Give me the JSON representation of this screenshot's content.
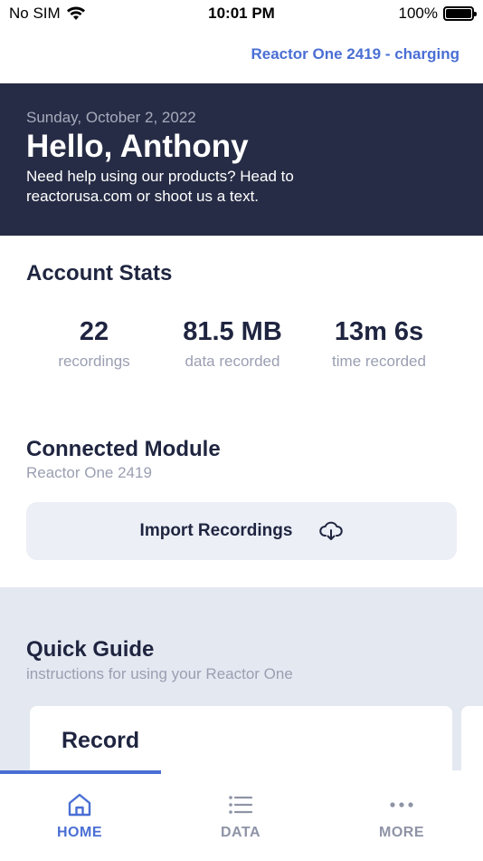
{
  "status_bar": {
    "carrier": "No SIM",
    "time": "10:01 PM",
    "battery": "100%",
    "battery_level": 1.0
  },
  "header": {
    "device_status": "Reactor One 2419 - charging"
  },
  "hero": {
    "date": "Sunday, October 2, 2022",
    "greeting": "Hello, Anthony",
    "help_text": "Need help using our products? Head to reactorusa.com or shoot us a text."
  },
  "account_stats": {
    "title": "Account Stats",
    "items": [
      {
        "value": "22",
        "label": "recordings"
      },
      {
        "value": "81.5 MB",
        "label": "data recorded"
      },
      {
        "value": "13m 6s",
        "label": "time recorded"
      }
    ]
  },
  "connected_module": {
    "title": "Connected Module",
    "module_name": "Reactor One 2419",
    "import_label": "Import Recordings"
  },
  "quick_guide": {
    "title": "Quick Guide",
    "subtitle": "instructions for using your Reactor One",
    "cards": [
      {
        "title": "Record"
      }
    ],
    "progress": 0.333
  },
  "tabs": [
    {
      "label": "HOME",
      "icon": "home-icon",
      "active": true
    },
    {
      "label": "DATA",
      "icon": "list-icon",
      "active": false
    },
    {
      "label": "MORE",
      "icon": "more-icon",
      "active": false
    }
  ],
  "colors": {
    "accent": "#4a6fd4",
    "hero_bg": "#262c45",
    "text_dark": "#1f2540",
    "text_muted": "#9a9fb2",
    "inactive_tab": "#8e93a6"
  }
}
